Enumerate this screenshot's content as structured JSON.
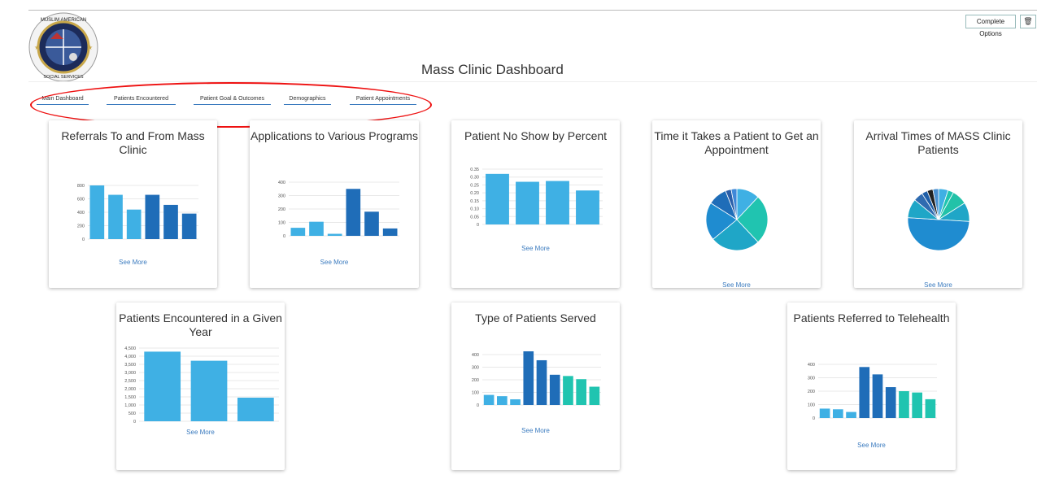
{
  "header": {
    "title": "Mass Clinic Dashboard",
    "options_label": "Complete Options",
    "logo_text": [
      "MUSLIM AMERICAN",
      "SOCIAL SERVICES"
    ]
  },
  "nav": [
    {
      "label": "Main Dashboard"
    },
    {
      "label": "Patients Encountered"
    },
    {
      "label": "Patient Goal & Outcomes"
    },
    {
      "label": "Demographics"
    },
    {
      "label": "Patient Appointments"
    }
  ],
  "colors": {
    "light_blue": "#3fb0e4",
    "dark_blue": "#1f6db8",
    "teal": "#20c4b0",
    "link": "#3b7bbf",
    "annotation": "#e11111"
  },
  "see_more": "See More",
  "chart_data": [
    {
      "type": "bar",
      "title": "Referrals To and From Mass Clinic",
      "ylim": [
        0,
        800
      ],
      "yticks": [
        "0",
        "200",
        "400",
        "600",
        "800"
      ],
      "values": [
        800,
        660,
        440,
        660,
        510,
        380
      ],
      "series_colors": [
        "light_blue",
        "light_blue",
        "light_blue",
        "dark_blue",
        "dark_blue",
        "dark_blue"
      ]
    },
    {
      "type": "bar",
      "title": "Applications to Various Programs",
      "ylim": [
        0,
        400
      ],
      "yticks": [
        "0",
        "100",
        "200",
        "300",
        "400"
      ],
      "values": [
        60,
        105,
        15,
        350,
        180,
        55
      ],
      "series_colors": [
        "light_blue",
        "light_blue",
        "light_blue",
        "dark_blue",
        "dark_blue",
        "dark_blue"
      ]
    },
    {
      "type": "bar",
      "title": "Patient No Show by Percent",
      "ylim": [
        0,
        0.35
      ],
      "yticks": [
        "0",
        "0.05",
        "0.10",
        "0.15",
        "0.20",
        "0.25",
        "0.30",
        "0.35"
      ],
      "values": [
        0.32,
        0.27,
        0.275,
        0.215
      ],
      "series_colors": [
        "light_blue",
        "light_blue",
        "light_blue",
        "light_blue"
      ]
    },
    {
      "type": "pie",
      "title": "Time it Takes a Patient to Get an Appointment",
      "values": [
        12,
        26,
        26,
        20,
        10,
        3,
        3
      ],
      "slice_colors": [
        "#3fb0e4",
        "#20c4b0",
        "#1fa6c7",
        "#1f8cd0",
        "#1f6db8",
        "#2a5ea8",
        "#3f88d8"
      ]
    },
    {
      "type": "pie",
      "title": "Arrival Times of MASS Clinic Patients",
      "values": [
        5,
        3,
        8,
        10,
        50,
        10,
        5,
        3,
        3,
        3
      ],
      "slice_colors": [
        "#3fb0e4",
        "#20c4b0",
        "#22c2a8",
        "#1fa6c7",
        "#1f8cd0",
        "#1fa6c7",
        "#2f6bb0",
        "#1f5fa8",
        "#222222",
        "#4a90d0"
      ]
    },
    {
      "type": "bar",
      "title": "Patients Encountered in a Given Year",
      "ylim": [
        0,
        4500
      ],
      "yticks": [
        "0",
        "500",
        "1,000",
        "1,500",
        "2,000",
        "2,500",
        "3,000",
        "3,500",
        "4,000",
        "4,500"
      ],
      "values": [
        4280,
        3720,
        1450
      ],
      "series_colors": [
        "light_blue",
        "light_blue",
        "light_blue"
      ]
    },
    {
      "type": "bar",
      "title": "Type of Patients Served",
      "ylim": [
        0,
        400
      ],
      "yticks": [
        "0",
        "100",
        "200",
        "300",
        "400"
      ],
      "values": [
        80,
        70,
        45,
        440,
        355,
        240,
        230,
        205,
        145
      ],
      "series_colors": [
        "light_blue",
        "light_blue",
        "light_blue",
        "dark_blue",
        "dark_blue",
        "dark_blue",
        "teal",
        "teal",
        "teal"
      ]
    },
    {
      "type": "bar",
      "title": "Patients Referred to Telehealth",
      "ylim": [
        0,
        400
      ],
      "yticks": [
        "0",
        "100",
        "200",
        "300",
        "400"
      ],
      "values": [
        70,
        65,
        45,
        380,
        325,
        230,
        200,
        190,
        140
      ],
      "series_colors": [
        "light_blue",
        "light_blue",
        "light_blue",
        "dark_blue",
        "dark_blue",
        "dark_blue",
        "teal",
        "teal",
        "teal"
      ]
    }
  ]
}
